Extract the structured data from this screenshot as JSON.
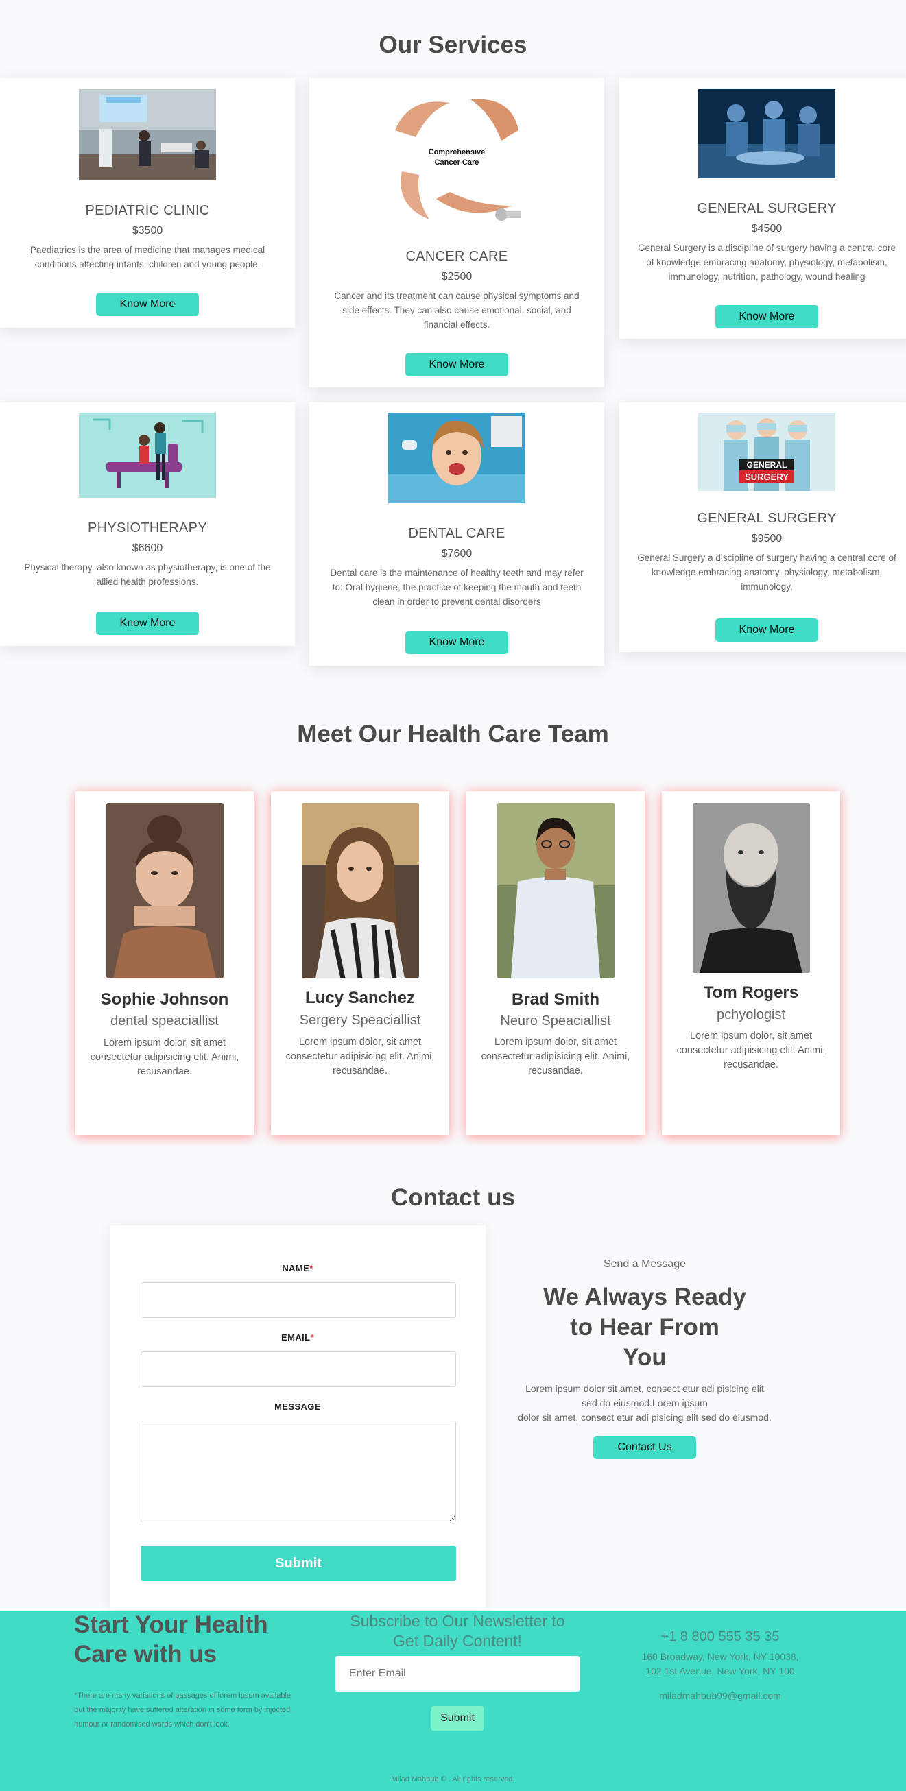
{
  "services": {
    "title": "Our Services",
    "know_more_label": "Know More",
    "cards": [
      {
        "name": "PEDIATRIC CLINIC",
        "price": "$3500",
        "desc": "Paediatrics is the area of medicine that manages medical conditions affecting infants, children and young people."
      },
      {
        "name": "CANCER CARE",
        "price": "$2500",
        "desc": "Cancer and its treatment can cause physical symptoms and side effects. They can also cause emotional, social, and financial effects.",
        "img_text_1": "Comprehensive",
        "img_text_2": "Cancer Care"
      },
      {
        "name": "GENERAL SURGERY",
        "price": "$4500",
        "desc": "General Surgery is a discipline of surgery having a central core of knowledge embracing anatomy, physiology, metabolism, immunology, nutrition, pathology, wound healing"
      },
      {
        "name": "PHYSIOTHERAPY",
        "price": "$6600",
        "desc": "Physical therapy, also known as physiotherapy, is one of the allied health professions."
      },
      {
        "name": "DENTAL CARE",
        "price": "$7600",
        "desc": "Dental care is the maintenance of healthy teeth and may refer to: Oral hygiene, the practice of keeping the mouth and teeth clean in order to prevent dental disorders"
      },
      {
        "name": "GENERAL SURGERY",
        "price": "$9500",
        "desc": "General Surgery a discipline of surgery having a central core of knowledge embracing anatomy, physiology, metabolism, immunology,",
        "img_text_1": "GENERAL",
        "img_text_2": "SURGERY"
      }
    ]
  },
  "team": {
    "title": "Meet Our Health Care Team",
    "members": [
      {
        "name": "Sophie Johnson",
        "role": "dental speaciallist",
        "desc": "Lorem ipsum dolor, sit amet consectetur adipisicing elit. Animi, recusandae."
      },
      {
        "name": "Lucy Sanchez",
        "role": "Sergery Speaciallist",
        "desc": "Lorem ipsum dolor, sit amet consectetur adipisicing elit. Animi, recusandae."
      },
      {
        "name": "Brad Smith",
        "role": "Neuro Speaciallist",
        "desc": "Lorem ipsum dolor, sit amet consectetur adipisicing elit. Animi, recusandae."
      },
      {
        "name": "Tom Rogers",
        "role": "pchyologist",
        "desc": "Lorem ipsum dolor, sit amet consectetur adipisicing elit. Animi, recusandae."
      }
    ]
  },
  "contact": {
    "title": "Contact us",
    "form": {
      "name_label": "NAME",
      "email_label": "EMAIL",
      "required_mark": "*",
      "message_label": "MESSAGE",
      "name_value": "",
      "email_value": "",
      "message_value": "",
      "submit_label": "Submit"
    },
    "side": {
      "kicker": "Send a Message",
      "heading_1": "We Always Ready",
      "heading_2": "to Hear From",
      "heading_3": "You",
      "body_1": "Lorem ipsum dolor sit amet, consect etur adi pisicing elit",
      "body_2": "sed do eiusmod.Lorem ipsum",
      "body_3": "dolor sit amet, consect etur adi pisicing elit sed do eiusmod.",
      "button_label": "Contact Us"
    }
  },
  "footer": {
    "headline_1": "Start Your Health",
    "headline_2": "Care with us",
    "note_1": "*There are many variations of passages of lorem ipsum available",
    "note_2": "but the majority have suffered alteration in some form by injected",
    "note_3": "humour or randomised words which don't look.",
    "newsletter_1": "Subscribe to Our Newsletter to",
    "newsletter_2": "Get Daily Content!",
    "email_placeholder": "Enter Email",
    "email_value": "",
    "subscribe_label": "Submit",
    "phone": "+1 8 800 555 35 35",
    "address_1": "160 Broadway, New York, NY 10038,",
    "address_2": "102 1st Avenue, New York, NY 100",
    "email": "miladmahbub99@gmail.com",
    "copyright": "Milad Mahbub © . All rights reserved."
  },
  "colors": {
    "accent": "#40dcc5",
    "team_shadow": "#ff4646",
    "required": "#e33333",
    "subscribe_button": "#7cf2c6"
  }
}
